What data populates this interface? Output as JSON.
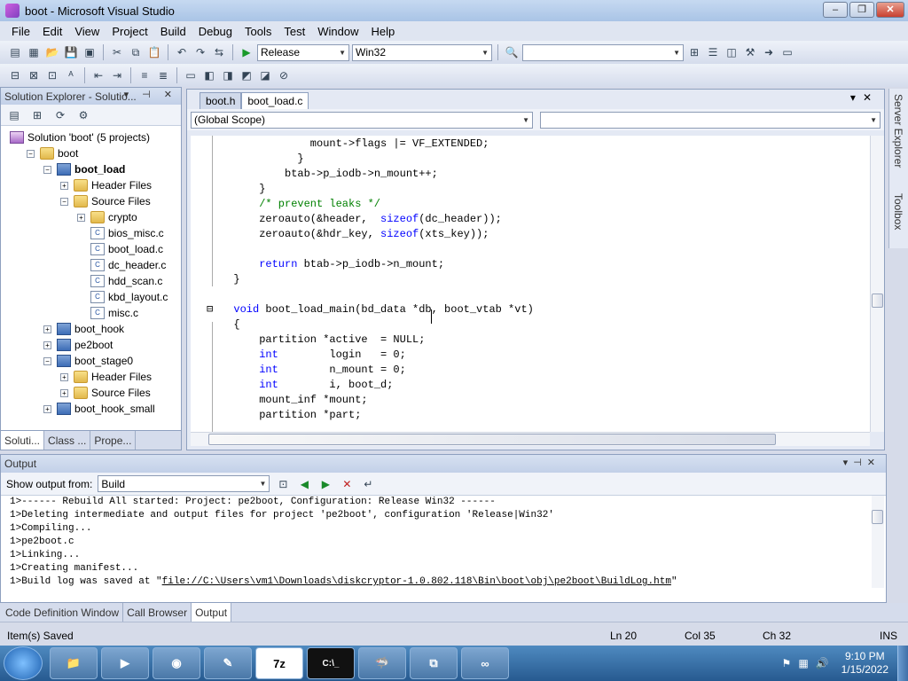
{
  "window": {
    "title": "boot - Microsoft Visual Studio",
    "min": "–",
    "max": "❐",
    "close": "✕"
  },
  "menu": [
    "File",
    "Edit",
    "View",
    "Project",
    "Build",
    "Debug",
    "Tools",
    "Test",
    "Window",
    "Help"
  ],
  "toolbar": {
    "config": "Release",
    "platform": "Win32",
    "find": ""
  },
  "solution_explorer": {
    "title": "Solution Explorer - Solutio...",
    "header_buttons": "▾ ⊣ ✕",
    "tree": [
      {
        "label": "Solution 'boot' (5 projects)",
        "level": 0,
        "icon": "solution-icon",
        "exp": ""
      },
      {
        "label": "boot",
        "level": 1,
        "icon": "folder-icon",
        "exp": "−"
      },
      {
        "label": "boot_load",
        "level": 2,
        "icon": "project-icon",
        "exp": "−",
        "bold": true
      },
      {
        "label": "Header Files",
        "level": 3,
        "icon": "folder-icon",
        "exp": "+"
      },
      {
        "label": "Source Files",
        "level": 3,
        "icon": "folder-icon",
        "exp": "−"
      },
      {
        "label": "crypto",
        "level": 4,
        "icon": "folder-icon",
        "exp": "+"
      },
      {
        "label": "bios_misc.c",
        "level": 4,
        "icon": "c-file-icon",
        "exp": ""
      },
      {
        "label": "boot_load.c",
        "level": 4,
        "icon": "c-file-icon",
        "exp": ""
      },
      {
        "label": "dc_header.c",
        "level": 4,
        "icon": "c-file-icon",
        "exp": ""
      },
      {
        "label": "hdd_scan.c",
        "level": 4,
        "icon": "c-file-icon",
        "exp": ""
      },
      {
        "label": "kbd_layout.c",
        "level": 4,
        "icon": "c-file-icon",
        "exp": ""
      },
      {
        "label": "misc.c",
        "level": 4,
        "icon": "c-file-icon",
        "exp": ""
      },
      {
        "label": "boot_hook",
        "level": 2,
        "icon": "project-icon",
        "exp": "+"
      },
      {
        "label": "pe2boot",
        "level": 2,
        "icon": "project-icon",
        "exp": "+"
      },
      {
        "label": "boot_stage0",
        "level": 2,
        "icon": "project-icon",
        "exp": "−"
      },
      {
        "label": "Header Files",
        "level": 3,
        "icon": "folder-icon",
        "exp": "+"
      },
      {
        "label": "Source Files",
        "level": 3,
        "icon": "folder-icon",
        "exp": "+"
      },
      {
        "label": "boot_hook_small",
        "level": 2,
        "icon": "project-icon",
        "exp": "+"
      }
    ],
    "tabs": [
      "Soluti...",
      "Class ...",
      "Prope..."
    ]
  },
  "editor": {
    "tabs": [
      "boot.h",
      "boot_load.c"
    ],
    "scope": "(Global Scope)",
    "member": "",
    "code": [
      {
        "indent": 14,
        "segs": [
          {
            "t": "mount->flags |= VF_EXTENDED;"
          }
        ]
      },
      {
        "indent": 12,
        "segs": [
          {
            "t": "}"
          }
        ]
      },
      {
        "indent": 10,
        "segs": [
          {
            "t": "btab->p_iodb->n_mount++;"
          }
        ]
      },
      {
        "indent": 6,
        "segs": [
          {
            "t": "}"
          }
        ]
      },
      {
        "indent": 6,
        "segs": [
          {
            "t": "/* prevent leaks */",
            "c": "cm"
          }
        ]
      },
      {
        "indent": 6,
        "segs": [
          {
            "t": "zeroauto(&header,  "
          },
          {
            "t": "sizeof",
            "c": "kw"
          },
          {
            "t": "(dc_header));"
          }
        ]
      },
      {
        "indent": 6,
        "segs": [
          {
            "t": "zeroauto(&hdr_key, "
          },
          {
            "t": "sizeof",
            "c": "kw"
          },
          {
            "t": "(xts_key));"
          }
        ]
      },
      {
        "indent": 0,
        "segs": [
          {
            "t": ""
          }
        ]
      },
      {
        "indent": 6,
        "segs": [
          {
            "t": "return",
            "c": "kw"
          },
          {
            "t": " btab->p_iodb->n_mount;"
          }
        ]
      },
      {
        "indent": 2,
        "segs": [
          {
            "t": "}"
          }
        ]
      },
      {
        "indent": 0,
        "segs": [
          {
            "t": ""
          }
        ]
      },
      {
        "indent": 2,
        "segs": [
          {
            "t": "void",
            "c": "kw"
          },
          {
            "t": " boot_load_main(bd_data *db, boot_vtab *vt)"
          }
        ]
      },
      {
        "indent": 2,
        "segs": [
          {
            "t": "{"
          }
        ]
      },
      {
        "indent": 6,
        "segs": [
          {
            "t": "partition *active  = NULL;"
          }
        ]
      },
      {
        "indent": 6,
        "segs": [
          {
            "t": "int",
            "c": "kw"
          },
          {
            "t": "        login   = 0;"
          }
        ]
      },
      {
        "indent": 6,
        "segs": [
          {
            "t": "int",
            "c": "kw"
          },
          {
            "t": "        n_mount = 0;"
          }
        ]
      },
      {
        "indent": 6,
        "segs": [
          {
            "t": "int",
            "c": "kw"
          },
          {
            "t": "        i, boot_d;"
          }
        ]
      },
      {
        "indent": 6,
        "segs": [
          {
            "t": "mount_inf *mount;"
          }
        ]
      },
      {
        "indent": 6,
        "segs": [
          {
            "t": "partition *part;"
          }
        ]
      }
    ]
  },
  "side_strip": {
    "server_explorer": "Server Explorer",
    "toolbox": "Toolbox"
  },
  "output": {
    "title": "Output",
    "show_from_label": "Show output from:",
    "show_from_value": "Build",
    "lines": [
      "1>------ Rebuild All started: Project: pe2boot, Configuration: Release Win32 ------",
      "1>Deleting intermediate and output files for project 'pe2boot', configuration 'Release|Win32'",
      "1>Compiling...",
      "1>pe2boot.c",
      "1>Linking...",
      "1>Creating manifest...",
      "1>Build log was saved at \""
    ],
    "log_link": "file://C:\\Users\\vm1\\Downloads\\diskcryptor-1.0.802.118\\Bin\\boot\\obj\\pe2boot\\BuildLog.htm",
    "log_end": "\""
  },
  "bottom_tabs": [
    "Code Definition Window",
    "Call Browser",
    "Output"
  ],
  "status": {
    "message": "Item(s) Saved",
    "ln": "Ln 20",
    "col": "Col 35",
    "ch": "Ch 32",
    "mode": "INS"
  },
  "taskbar": {
    "time": "9:10 PM",
    "date": "1/15/2022",
    "apps": [
      "explorer",
      "media",
      "chrome",
      "notepad",
      "7z",
      "cmd",
      "wireshark",
      "network",
      "vs"
    ],
    "sevenzip": "7z",
    "cmd": "C:\\_"
  }
}
